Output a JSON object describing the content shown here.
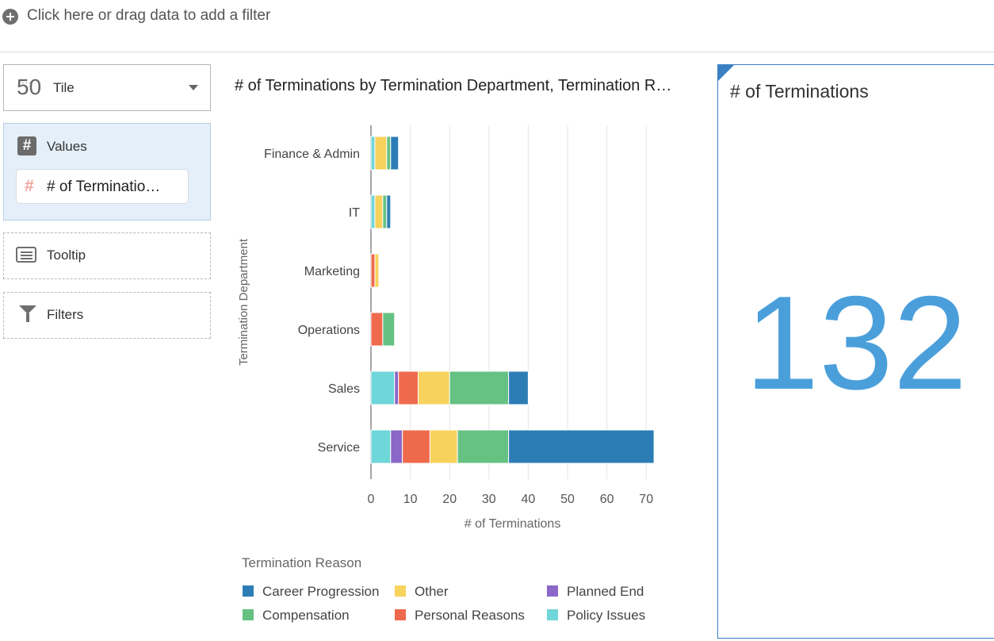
{
  "filter_bar": {
    "text": "Click here or drag data to add a filter",
    "icon": "plus-circle-icon"
  },
  "left_panel": {
    "visualization": {
      "icon_text": "50",
      "label": "Tile",
      "icon": "tile-number-icon"
    },
    "values": {
      "label": "Values",
      "item": "# of Terminatio…",
      "icon": "hash-icon"
    },
    "tooltip": {
      "label": "Tooltip",
      "icon": "tooltip-icon"
    },
    "filters": {
      "label": "Filters",
      "icon": "funnel-icon"
    }
  },
  "chart_title": "# of Terminations by Termination Department, Termination R…",
  "chart_data": {
    "type": "bar",
    "orientation": "horizontal",
    "stacked": true,
    "categories": [
      "Finance & Admin",
      "IT",
      "Marketing",
      "Operations",
      "Sales",
      "Service"
    ],
    "series": [
      {
        "name": "Policy Issues",
        "color": "#6fd6d9",
        "values": [
          1,
          1,
          0,
          0,
          6,
          5
        ]
      },
      {
        "name": "Planned End",
        "color": "#8a67c8",
        "values": [
          0,
          0,
          0,
          0,
          1,
          3
        ]
      },
      {
        "name": "Personal Reasons",
        "color": "#ef6a4c",
        "values": [
          0,
          0,
          1,
          3,
          5,
          7
        ]
      },
      {
        "name": "Other",
        "color": "#f7d25c",
        "values": [
          3,
          2,
          1,
          0,
          8,
          7
        ]
      },
      {
        "name": "Compensation",
        "color": "#66c283",
        "values": [
          1,
          1,
          0,
          3,
          15,
          13
        ]
      },
      {
        "name": "Career Progression",
        "color": "#2c7db6",
        "values": [
          2,
          1,
          0,
          0,
          5,
          37
        ]
      }
    ],
    "xlabel": "# of Terminations",
    "ylabel": "Termination Department",
    "xlim": [
      0,
      72
    ],
    "xticks": [
      0,
      10,
      20,
      30,
      40,
      50,
      60,
      70
    ],
    "grid": true,
    "legend": {
      "title": "Termination Reason",
      "placement": "bottom",
      "items": [
        {
          "name": "Career Progression",
          "color": "#2c7db6"
        },
        {
          "name": "Other",
          "color": "#f7d25c"
        },
        {
          "name": "Planned End",
          "color": "#8a67c8"
        },
        {
          "name": "Compensation",
          "color": "#66c283"
        },
        {
          "name": "Personal Reasons",
          "color": "#ef6a4c"
        },
        {
          "name": "Policy Issues",
          "color": "#6fd6d9"
        }
      ]
    }
  },
  "tile": {
    "title": "# of Terminations",
    "value": "132",
    "color": "#4a9fdb"
  }
}
